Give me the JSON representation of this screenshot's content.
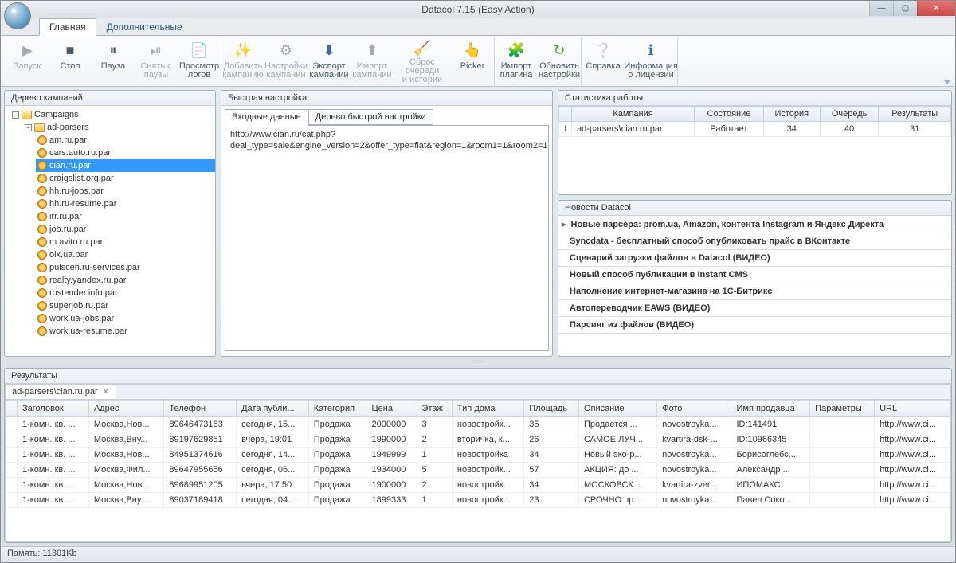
{
  "title": "Datacol 7.15 (Easy Action)",
  "tabs": {
    "main": "Главная",
    "extra": "Дополнительные"
  },
  "ribbon": {
    "start": "Запуск",
    "stop": "Стоп",
    "pause": "Пауза",
    "unpause1": "Снять с",
    "unpause2": "паузы",
    "logs1": "Просмотр",
    "logs2": "логов",
    "addc1": "Добавить",
    "addc2": "кампанию",
    "setc1": "Настройки",
    "setc2": "кампании",
    "expc1": "Экспорт",
    "expc2": "кампании",
    "impc1": "Импорт",
    "impc2": "кампании",
    "reset1": "Сброс очереди",
    "reset2": "и истории",
    "picker": "Picker",
    "implug1": "Импорт",
    "implug2": "плагина",
    "updset1": "Обновить",
    "updset2": "настройки",
    "help": "Справка",
    "lic1": "Информация",
    "lic2": "о лицензии"
  },
  "tree": {
    "title": "Дерево кампаний",
    "root": "Campaigns",
    "folder": "ad-parsers",
    "items": [
      "am.ru.par",
      "cars.auto.ru.par",
      "cian.ru.par",
      "craigslist.org.par",
      "hh.ru-jobs.par",
      "hh.ru-resume.par",
      "irr.ru.par",
      "job.ru.par",
      "m.avito.ru.par",
      "olx.ua.par",
      "pulscen.ru-services.par",
      "realty.yandex.ru.par",
      "rostender.info.par",
      "superjob.ru.par",
      "work.ua-jobs.par",
      "work.ua-resume.par"
    ],
    "selected": "cian.ru.par"
  },
  "quick": {
    "title": "Быстрая настройка",
    "tab1": "Входные данные",
    "tab2": "Дерево быстрой настройки",
    "text": "http://www.cian.ru/cat.php?deal_type=sale&engine_version=2&offer_type=flat&region=1&room1=1&room2=1"
  },
  "stats": {
    "title": "Статистика работы",
    "headers": [
      "Кампания",
      "Состояние",
      "История",
      "Очередь",
      "Результаты"
    ],
    "row": {
      "camp": "ad-parsers\\cian.ru.par",
      "state": "Работает",
      "hist": "34",
      "queue": "40",
      "res": "31"
    }
  },
  "news": {
    "title": "Новости Datacol",
    "items": [
      "Новые парсера: prom.ua, Amazon, контента Instagram и Яндекс Директа",
      "Syncdata - бесплатный способ опубликовать прайс в ВКонтакте",
      "Сценарий загрузки файлов в Datacol (ВИДЕО)",
      "Новый способ публикации в Instant CMS",
      "Наполнение интернет-магазина на 1С-Битрикс",
      "Автопереводчик EAWS (ВИДЕО)",
      "Парсинг из файлов (ВИДЕО)"
    ]
  },
  "results": {
    "title": "Результаты",
    "tab": "ad-parsers\\cian.ru.par",
    "headers": [
      "Заголовок",
      "Адрес",
      "Телефон",
      "Дата публи...",
      "Категория",
      "Цена",
      "Этаж",
      "Тип дома",
      "Площадь",
      "Описание",
      "Фото",
      "Имя продавца",
      "Параметры",
      "URL"
    ],
    "rows": [
      [
        "1-комн. кв. ...",
        "Москва,Нов...",
        "89646473163",
        "сегодня, 15...",
        "Продажа",
        "2000000",
        "3",
        "новостройк...",
        "35",
        "Продается ...",
        "novostroyka...",
        "ID:141491",
        "",
        "http://www.ci..."
      ],
      [
        "1-комн. кв. ...",
        "Москва,Вну...",
        "89197629851",
        "вчера, 19:01",
        "Продажа",
        "1990000",
        "2",
        "вторичка, к...",
        "26",
        "САМОЕ ЛУЧ...",
        "kvartira-dsk-...",
        "ID:10966345",
        "",
        "http://www.ci..."
      ],
      [
        "1-комн. кв. ...",
        "Москва,Нов...",
        "84951374616",
        "сегодня, 14...",
        "Продажа",
        "1949999",
        "1",
        "новостройка",
        "34",
        "Новый эко-р...",
        "novostroyka...",
        "Борисоглебс...",
        "",
        "http://www.ci..."
      ],
      [
        "1-комн. кв. ...",
        "Москва,Фил...",
        "89647955656",
        "сегодня, 06...",
        "Продажа",
        "1934000",
        "5",
        "новостройк...",
        "57",
        "АКЦИЯ: до ...",
        "novostroyka...",
        "Александр ...",
        "",
        "http://www.ci..."
      ],
      [
        "1-комн. кв. ...",
        "Москва,Нов...",
        "89689951205",
        "вчера, 17:50",
        "Продажа",
        "1900000",
        "2",
        "новостройк...",
        "34",
        "МОСКОВСК...",
        "kvartira-zver...",
        "ИПОМАКС",
        "",
        "http://www.ci..."
      ],
      [
        "1-комн. кв. ...",
        "Москва,Вну...",
        "89037189418",
        "сегодня, 04...",
        "Продажа",
        "1899333",
        "1",
        "новостройк...",
        "23",
        "СРОЧНО пр...",
        "novostroyka...",
        "Павел Соко...",
        "",
        "http://www.ci..."
      ]
    ]
  },
  "status": "Память: 11301Kb"
}
